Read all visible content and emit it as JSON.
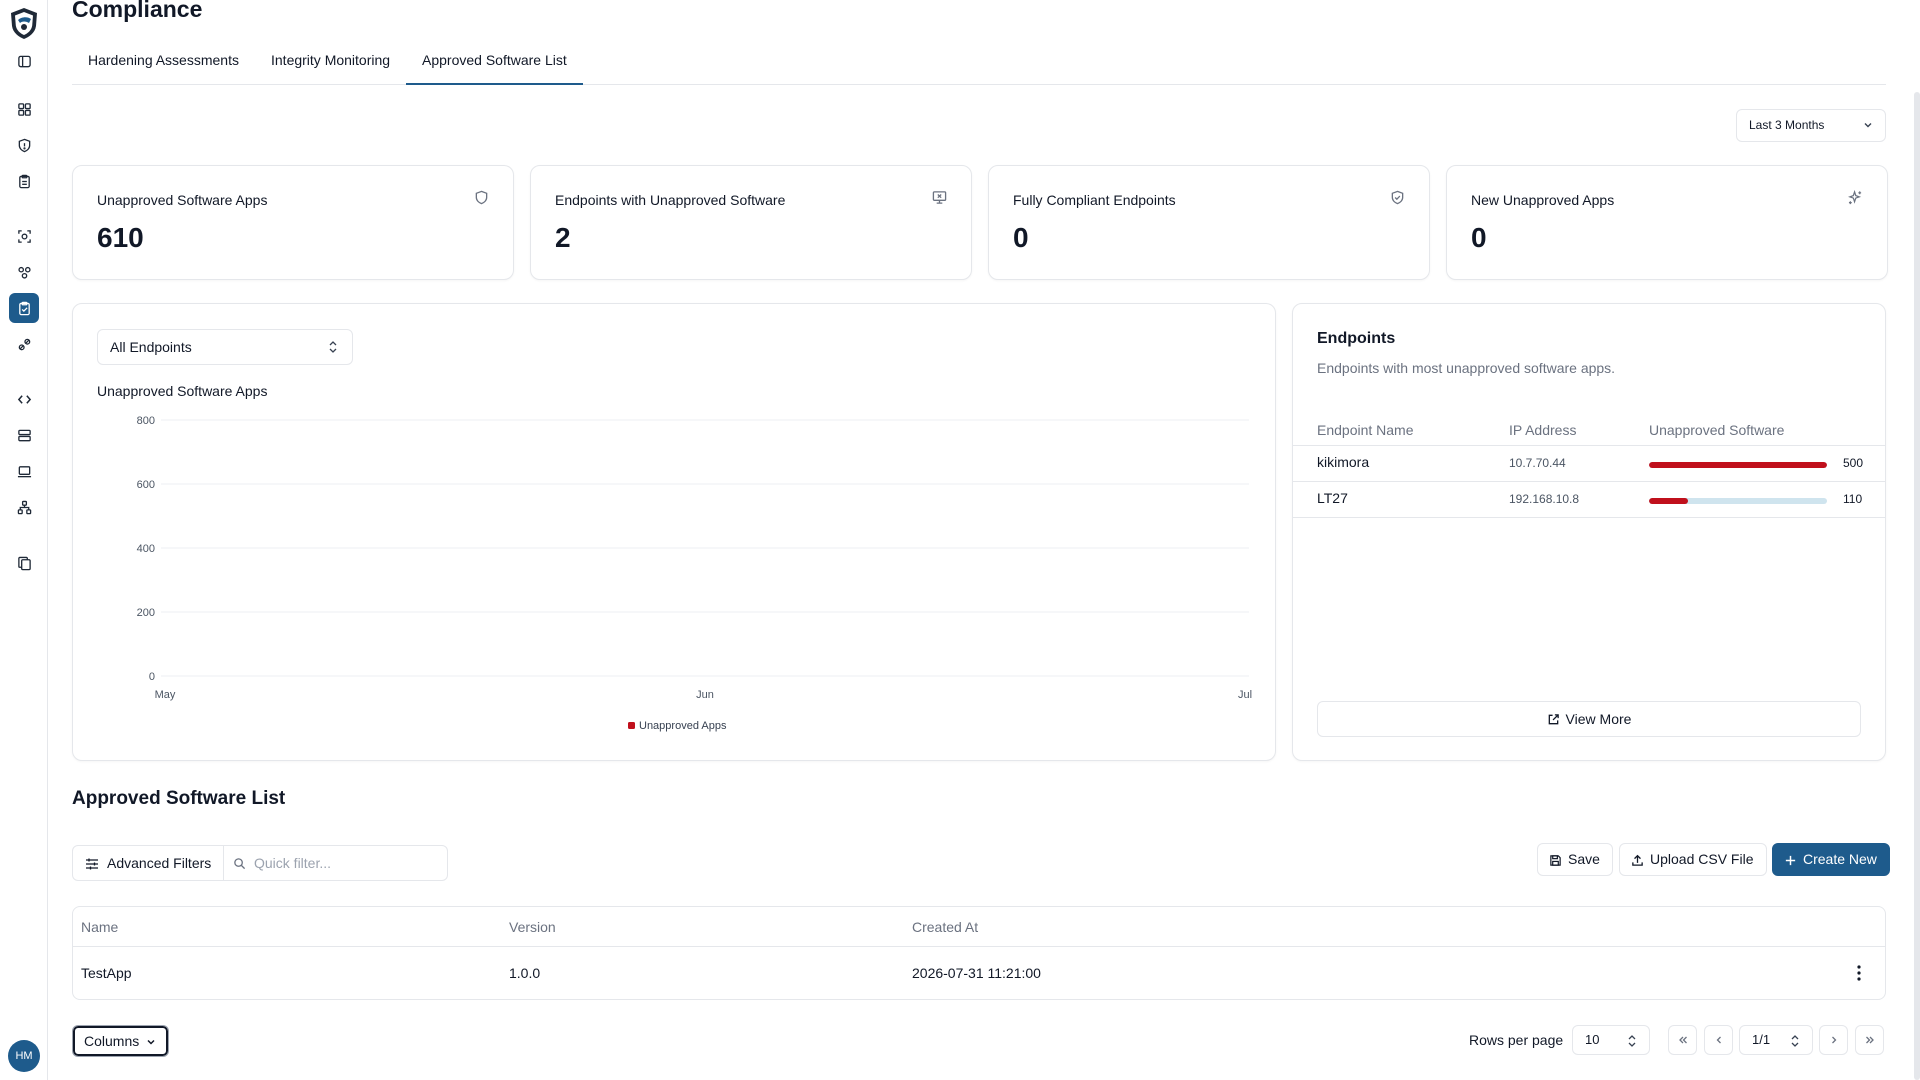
{
  "header": {
    "title": "Compliance",
    "tabs": [
      "Hardening Assessments",
      "Integrity Monitoring",
      "Approved Software List"
    ],
    "active_tab": "Approved Software List"
  },
  "user": {
    "initials": "HM"
  },
  "time_range": {
    "selected": "Last 3 Months"
  },
  "stats": [
    {
      "label": "Unapproved Software Apps",
      "value": "610",
      "icon": "shield-icon"
    },
    {
      "label": "Endpoints with Unapproved Software",
      "value": "2",
      "icon": "monitor-x-icon"
    },
    {
      "label": "Fully Compliant Endpoints",
      "value": "0",
      "icon": "shield-check-icon"
    },
    {
      "label": "New Unapproved Apps",
      "value": "0",
      "icon": "sparkles-icon"
    }
  ],
  "chart": {
    "endpoint_filter": "All Endpoints"
  },
  "chart_data": {
    "type": "line",
    "title": "Unapproved Software Apps",
    "x": [
      "May",
      "Jun",
      "Jul"
    ],
    "yticks": [
      "800",
      "600",
      "400",
      "200",
      "0"
    ],
    "ylim": [
      0,
      800
    ],
    "series": [
      {
        "name": "Unapproved Apps",
        "values": [],
        "color": "#c0101c"
      }
    ],
    "grid": true,
    "legend": "bottom"
  },
  "endpoints": {
    "title": "Endpoints",
    "subtitle": "Endpoints with most unapproved software apps.",
    "columns": [
      "Endpoint Name",
      "IP Address",
      "Unapproved Software"
    ],
    "rows": [
      {
        "name": "kikimora",
        "ip": "10.7.70.44",
        "count": "500",
        "fraction": 1.0
      },
      {
        "name": "LT27",
        "ip": "192.168.10.8",
        "count": "110",
        "fraction": 0.22
      }
    ],
    "view_more": "View More"
  },
  "software_list": {
    "title": "Approved Software List",
    "advanced_filters": "Advanced Filters",
    "quick_filter_placeholder": "Quick filter...",
    "save": "Save",
    "upload_csv": "Upload CSV File",
    "create_new": "Create New",
    "columns": [
      "Name",
      "Version",
      "Created At"
    ],
    "rows": [
      {
        "name": "TestApp",
        "version": "1.0.0",
        "created_at": "2026-07-31 11:21:00"
      }
    ]
  },
  "footer": {
    "columns_button": "Columns",
    "rows_per_page_label": "Rows per page",
    "rows_per_page": "10",
    "page": "1/1"
  },
  "colors": {
    "accent": "#1e5b8c",
    "danger": "#c0101c",
    "bar_track": "#cfe4ee"
  }
}
